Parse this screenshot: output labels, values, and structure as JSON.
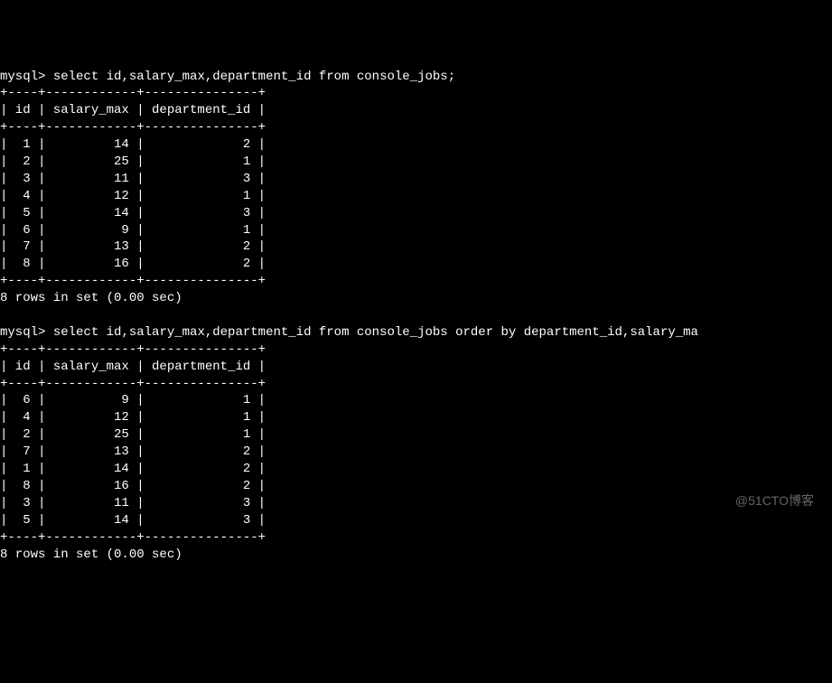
{
  "prompt": "mysql>",
  "query1": {
    "sql": "select id,salary_max,department_id from console_jobs;",
    "columns": [
      "id",
      "salary_max",
      "department_id"
    ],
    "rows": [
      {
        "id": 1,
        "salary_max": 14,
        "department_id": 2
      },
      {
        "id": 2,
        "salary_max": 25,
        "department_id": 1
      },
      {
        "id": 3,
        "salary_max": 11,
        "department_id": 3
      },
      {
        "id": 4,
        "salary_max": 12,
        "department_id": 1
      },
      {
        "id": 5,
        "salary_max": 14,
        "department_id": 3
      },
      {
        "id": 6,
        "salary_max": 9,
        "department_id": 1
      },
      {
        "id": 7,
        "salary_max": 13,
        "department_id": 2
      },
      {
        "id": 8,
        "salary_max": 16,
        "department_id": 2
      }
    ],
    "footer": "8 rows in set (0.00 sec)"
  },
  "query2": {
    "sql": "select id,salary_max,department_id from console_jobs order by department_id,salary_ma",
    "columns": [
      "id",
      "salary_max",
      "department_id"
    ],
    "rows": [
      {
        "id": 6,
        "salary_max": 9,
        "department_id": 1
      },
      {
        "id": 4,
        "salary_max": 12,
        "department_id": 1
      },
      {
        "id": 2,
        "salary_max": 25,
        "department_id": 1
      },
      {
        "id": 7,
        "salary_max": 13,
        "department_id": 2
      },
      {
        "id": 1,
        "salary_max": 14,
        "department_id": 2
      },
      {
        "id": 8,
        "salary_max": 16,
        "department_id": 2
      },
      {
        "id": 3,
        "salary_max": 11,
        "department_id": 3
      },
      {
        "id": 5,
        "salary_max": 14,
        "department_id": 3
      }
    ],
    "footer": "8 rows in set (0.00 sec)"
  },
  "watermark": "@51CTO博客",
  "widths": {
    "id": 4,
    "salary_max": 12,
    "department_id": 15
  }
}
